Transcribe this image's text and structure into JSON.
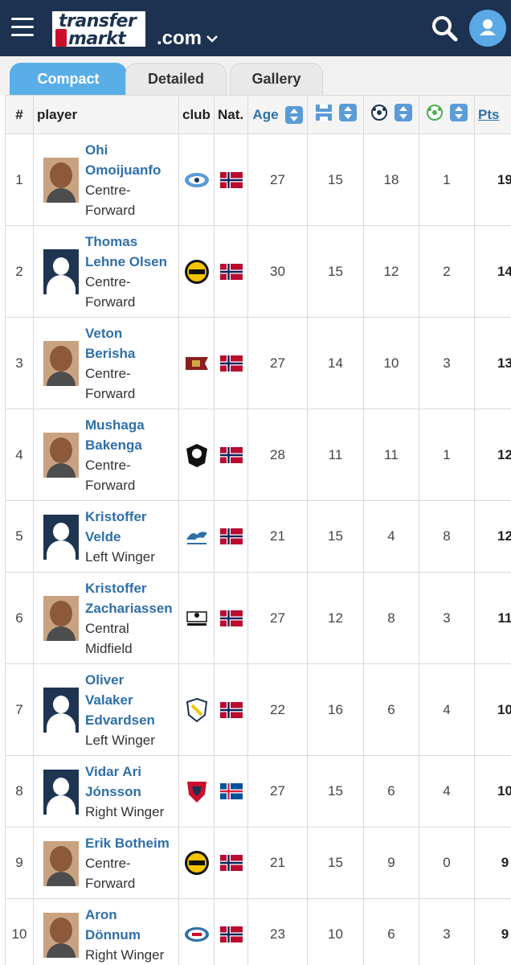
{
  "header": {
    "logo_line1": "transfer",
    "logo_line2": "markt",
    "domain": ".com",
    "icons": [
      "menu-icon",
      "chevron-down-icon",
      "search-icon",
      "user-icon"
    ],
    "colors": {
      "bar": "#1c3250",
      "accent": "#5aaee8",
      "link": "#2e6fa8"
    }
  },
  "tabs": [
    {
      "label": "Compact",
      "active": true
    },
    {
      "label": "Detailed",
      "active": false
    },
    {
      "label": "Gallery",
      "active": false
    }
  ],
  "columns": {
    "rank": "#",
    "player": "player",
    "club": "club",
    "nat": "Nat.",
    "age": "Age",
    "pts": "Pts"
  },
  "rows": [
    {
      "rank": "1",
      "name": [
        "Ohi",
        "Omoijuanfo"
      ],
      "position": [
        "Centre-",
        "Forward"
      ],
      "age": "27",
      "apps": "15",
      "goals": "18",
      "assists": "1",
      "pts": "19"
    },
    {
      "rank": "2",
      "name": [
        "Thomas",
        "Lehne Olsen"
      ],
      "position": [
        "Centre-",
        "Forward"
      ],
      "age": "30",
      "apps": "15",
      "goals": "12",
      "assists": "2",
      "pts": "14"
    },
    {
      "rank": "3",
      "name": [
        "Veton",
        "Berisha"
      ],
      "position": [
        "Centre-",
        "Forward"
      ],
      "age": "27",
      "apps": "14",
      "goals": "10",
      "assists": "3",
      "pts": "13"
    },
    {
      "rank": "4",
      "name": [
        "Mushaga",
        "Bakenga"
      ],
      "position": [
        "Centre-",
        "Forward"
      ],
      "age": "28",
      "apps": "11",
      "goals": "11",
      "assists": "1",
      "pts": "12"
    },
    {
      "rank": "5",
      "name": [
        "Kristoffer",
        "Velde"
      ],
      "position": [
        "Left Winger"
      ],
      "age": "21",
      "apps": "15",
      "goals": "4",
      "assists": "8",
      "pts": "12"
    },
    {
      "rank": "6",
      "name": [
        "Kristoffer",
        "Zachariassen"
      ],
      "position": [
        "Central",
        "Midfield"
      ],
      "age": "27",
      "apps": "12",
      "goals": "8",
      "assists": "3",
      "pts": "11"
    },
    {
      "rank": "7",
      "name": [
        "Oliver",
        "Valaker",
        "Edvardsen"
      ],
      "position": [
        "Left Winger"
      ],
      "age": "22",
      "apps": "16",
      "goals": "6",
      "assists": "4",
      "pts": "10"
    },
    {
      "rank": "8",
      "name": [
        "Vidar Ari",
        "Jónsson"
      ],
      "position": [
        "Right Winger"
      ],
      "age": "27",
      "apps": "15",
      "goals": "6",
      "assists": "4",
      "pts": "10"
    },
    {
      "rank": "9",
      "name": [
        "Erik Botheim"
      ],
      "position": [
        "Centre-",
        "Forward"
      ],
      "age": "21",
      "apps": "15",
      "goals": "9",
      "assists": "0",
      "pts": "9"
    },
    {
      "rank": "10",
      "name": [
        "Aron",
        "Dönnum"
      ],
      "position": [
        "Right Winger"
      ],
      "age": "23",
      "apps": "10",
      "goals": "6",
      "assists": "3",
      "pts": "9"
    }
  ]
}
